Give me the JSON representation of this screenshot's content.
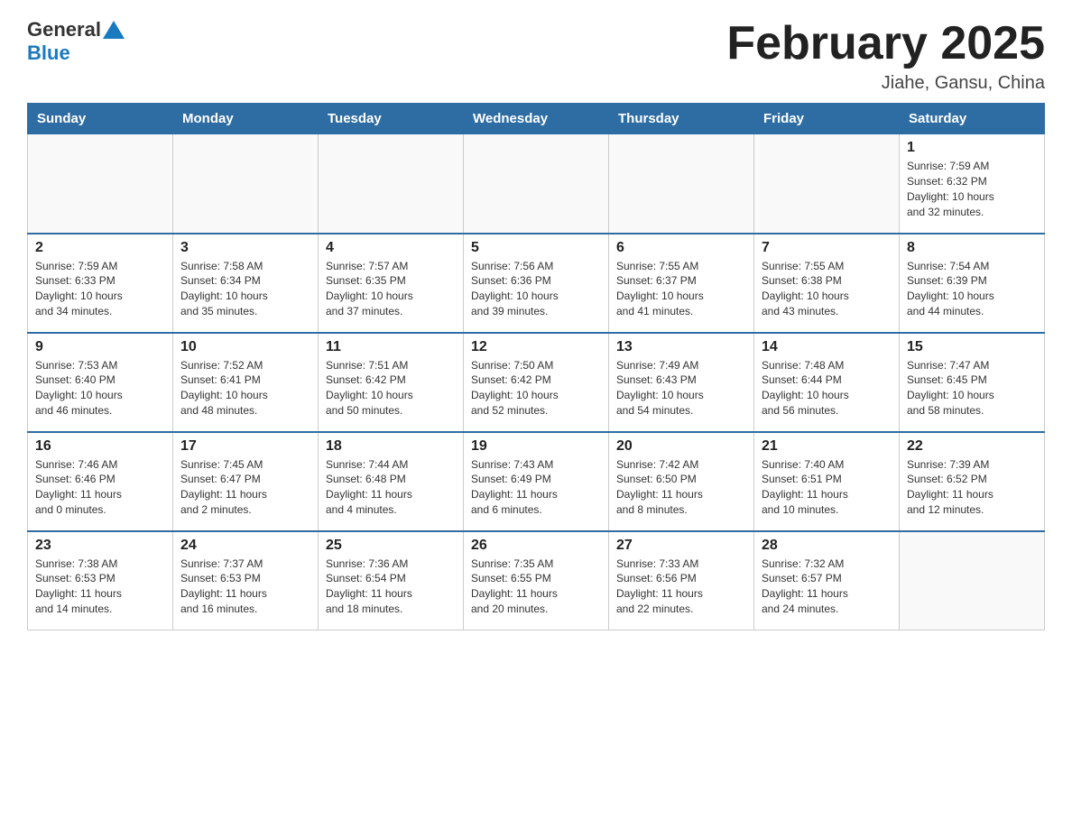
{
  "header": {
    "logo_general": "General",
    "logo_blue": "Blue",
    "title": "February 2025",
    "subtitle": "Jiahe, Gansu, China"
  },
  "weekdays": [
    "Sunday",
    "Monday",
    "Tuesday",
    "Wednesday",
    "Thursday",
    "Friday",
    "Saturday"
  ],
  "weeks": [
    [
      {
        "day": "",
        "info": ""
      },
      {
        "day": "",
        "info": ""
      },
      {
        "day": "",
        "info": ""
      },
      {
        "day": "",
        "info": ""
      },
      {
        "day": "",
        "info": ""
      },
      {
        "day": "",
        "info": ""
      },
      {
        "day": "1",
        "info": "Sunrise: 7:59 AM\nSunset: 6:32 PM\nDaylight: 10 hours\nand 32 minutes."
      }
    ],
    [
      {
        "day": "2",
        "info": "Sunrise: 7:59 AM\nSunset: 6:33 PM\nDaylight: 10 hours\nand 34 minutes."
      },
      {
        "day": "3",
        "info": "Sunrise: 7:58 AM\nSunset: 6:34 PM\nDaylight: 10 hours\nand 35 minutes."
      },
      {
        "day": "4",
        "info": "Sunrise: 7:57 AM\nSunset: 6:35 PM\nDaylight: 10 hours\nand 37 minutes."
      },
      {
        "day": "5",
        "info": "Sunrise: 7:56 AM\nSunset: 6:36 PM\nDaylight: 10 hours\nand 39 minutes."
      },
      {
        "day": "6",
        "info": "Sunrise: 7:55 AM\nSunset: 6:37 PM\nDaylight: 10 hours\nand 41 minutes."
      },
      {
        "day": "7",
        "info": "Sunrise: 7:55 AM\nSunset: 6:38 PM\nDaylight: 10 hours\nand 43 minutes."
      },
      {
        "day": "8",
        "info": "Sunrise: 7:54 AM\nSunset: 6:39 PM\nDaylight: 10 hours\nand 44 minutes."
      }
    ],
    [
      {
        "day": "9",
        "info": "Sunrise: 7:53 AM\nSunset: 6:40 PM\nDaylight: 10 hours\nand 46 minutes."
      },
      {
        "day": "10",
        "info": "Sunrise: 7:52 AM\nSunset: 6:41 PM\nDaylight: 10 hours\nand 48 minutes."
      },
      {
        "day": "11",
        "info": "Sunrise: 7:51 AM\nSunset: 6:42 PM\nDaylight: 10 hours\nand 50 minutes."
      },
      {
        "day": "12",
        "info": "Sunrise: 7:50 AM\nSunset: 6:42 PM\nDaylight: 10 hours\nand 52 minutes."
      },
      {
        "day": "13",
        "info": "Sunrise: 7:49 AM\nSunset: 6:43 PM\nDaylight: 10 hours\nand 54 minutes."
      },
      {
        "day": "14",
        "info": "Sunrise: 7:48 AM\nSunset: 6:44 PM\nDaylight: 10 hours\nand 56 minutes."
      },
      {
        "day": "15",
        "info": "Sunrise: 7:47 AM\nSunset: 6:45 PM\nDaylight: 10 hours\nand 58 minutes."
      }
    ],
    [
      {
        "day": "16",
        "info": "Sunrise: 7:46 AM\nSunset: 6:46 PM\nDaylight: 11 hours\nand 0 minutes."
      },
      {
        "day": "17",
        "info": "Sunrise: 7:45 AM\nSunset: 6:47 PM\nDaylight: 11 hours\nand 2 minutes."
      },
      {
        "day": "18",
        "info": "Sunrise: 7:44 AM\nSunset: 6:48 PM\nDaylight: 11 hours\nand 4 minutes."
      },
      {
        "day": "19",
        "info": "Sunrise: 7:43 AM\nSunset: 6:49 PM\nDaylight: 11 hours\nand 6 minutes."
      },
      {
        "day": "20",
        "info": "Sunrise: 7:42 AM\nSunset: 6:50 PM\nDaylight: 11 hours\nand 8 minutes."
      },
      {
        "day": "21",
        "info": "Sunrise: 7:40 AM\nSunset: 6:51 PM\nDaylight: 11 hours\nand 10 minutes."
      },
      {
        "day": "22",
        "info": "Sunrise: 7:39 AM\nSunset: 6:52 PM\nDaylight: 11 hours\nand 12 minutes."
      }
    ],
    [
      {
        "day": "23",
        "info": "Sunrise: 7:38 AM\nSunset: 6:53 PM\nDaylight: 11 hours\nand 14 minutes."
      },
      {
        "day": "24",
        "info": "Sunrise: 7:37 AM\nSunset: 6:53 PM\nDaylight: 11 hours\nand 16 minutes."
      },
      {
        "day": "25",
        "info": "Sunrise: 7:36 AM\nSunset: 6:54 PM\nDaylight: 11 hours\nand 18 minutes."
      },
      {
        "day": "26",
        "info": "Sunrise: 7:35 AM\nSunset: 6:55 PM\nDaylight: 11 hours\nand 20 minutes."
      },
      {
        "day": "27",
        "info": "Sunrise: 7:33 AM\nSunset: 6:56 PM\nDaylight: 11 hours\nand 22 minutes."
      },
      {
        "day": "28",
        "info": "Sunrise: 7:32 AM\nSunset: 6:57 PM\nDaylight: 11 hours\nand 24 minutes."
      },
      {
        "day": "",
        "info": ""
      }
    ]
  ]
}
